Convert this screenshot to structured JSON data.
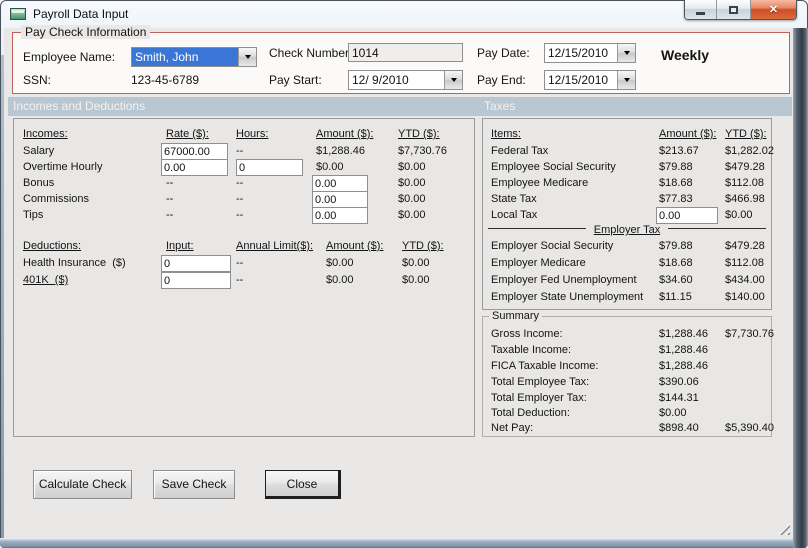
{
  "window": {
    "title": "Payroll Data Input"
  },
  "icons": {
    "app": "form-window-icon",
    "minimize": "minimize-glyph",
    "maximize": "maximize-glyph",
    "close_glyph": "✕"
  },
  "colors": {
    "groupbox_border": "#C0605C",
    "band_bg": "#B9C7D3",
    "selection_bg": "#3A76D6",
    "close_button_red": "#CE4E26"
  },
  "paycheck": {
    "group_label": "Pay Check Information",
    "employee_name_label": "Employee Name:",
    "employee_name_value": "Smith, John",
    "ssn_label": "SSN:",
    "ssn_value": "123-45-6789",
    "check_number_label": "Check Number:",
    "check_number_value": "1014",
    "pay_start_label": "Pay Start:",
    "pay_start_value": "12/ 9/2010",
    "pay_date_label": "Pay Date:",
    "pay_date_value": "12/15/2010",
    "pay_end_label": "Pay End:",
    "pay_end_value": "12/15/2010",
    "frequency": "Weekly"
  },
  "bands": {
    "left": "Incomes and Deductions",
    "right": "Taxes"
  },
  "inc": {
    "h0": "Incomes:",
    "h1": "Rate ($):",
    "h2": "Hours:",
    "h3": "Amount ($):",
    "h4": "YTD ($):",
    "rows": [
      {
        "label": "Salary",
        "rate": "67000.00",
        "hours": "--",
        "amount": "$1,288.46",
        "ytd": "$7,730.76"
      },
      {
        "label": "Overtime Hourly",
        "rate": "0.00",
        "hours": "0",
        "amount": "$0.00",
        "ytd": "$0.00"
      },
      {
        "label": "Bonus",
        "rate": "--",
        "hours": "--",
        "amount": "0.00",
        "ytd": "$0.00"
      },
      {
        "label": "Commissions",
        "rate": "--",
        "hours": "--",
        "amount": "0.00",
        "ytd": "$0.00"
      },
      {
        "label": "Tips",
        "rate": "--",
        "hours": "--",
        "amount": "0.00",
        "ytd": "$0.00"
      }
    ]
  },
  "ded": {
    "h0": "Deductions:",
    "h1": "Input:",
    "h2": "Annual Limit($):",
    "h3": "Amount ($):",
    "h4": "YTD ($):",
    "rows": [
      {
        "label": "Health Insurance  ($)",
        "input": "0",
        "limit": "--",
        "amount": "$0.00",
        "ytd": "$0.00"
      },
      {
        "label": "401K  ($)",
        "input": "0",
        "limit": "--",
        "amount": "$0.00",
        "ytd": "$0.00"
      }
    ]
  },
  "tax": {
    "h0": "Items:",
    "h1": "Amount ($):",
    "h2": "YTD ($):",
    "rows": [
      {
        "label": "Federal Tax",
        "amount": "$213.67",
        "ytd": "$1,282.02"
      },
      {
        "label": "Employee Social Security",
        "amount": "$79.88",
        "ytd": "$479.28"
      },
      {
        "label": "Employee Medicare",
        "amount": "$18.68",
        "ytd": "$112.08"
      },
      {
        "label": "State Tax",
        "amount": "$77.83",
        "ytd": "$466.98"
      },
      {
        "label": "Local Tax",
        "amount": "0.00",
        "ytd": "$0.00"
      }
    ],
    "employer_label": "Employer Tax",
    "emp_rows": [
      {
        "label": "Employer Social Security",
        "amount": "$79.88",
        "ytd": "$479.28"
      },
      {
        "label": "Employer Medicare",
        "amount": "$18.68",
        "ytd": "$112.08"
      },
      {
        "label": "Employer Fed Unemployment",
        "amount": "$34.60",
        "ytd": "$434.00"
      },
      {
        "label": "Employer State Unemployment",
        "amount": "$11.15",
        "ytd": "$140.00"
      }
    ]
  },
  "summary": {
    "group_label": "Summary",
    "rows": [
      {
        "label": "Gross Income:",
        "amount": "$1,288.46",
        "ytd": "$7,730.76"
      },
      {
        "label": "Taxable Income:",
        "amount": "$1,288.46",
        "ytd": ""
      },
      {
        "label": "FICA Taxable Income:",
        "amount": "$1,288.46",
        "ytd": ""
      },
      {
        "label": "Total Employee Tax:",
        "amount": "$390.06",
        "ytd": ""
      },
      {
        "label": "Total Employer Tax:",
        "amount": "$144.31",
        "ytd": ""
      },
      {
        "label": "Total Deduction:",
        "amount": "$0.00",
        "ytd": ""
      },
      {
        "label": "Net Pay:",
        "amount": "$898.40",
        "ytd": "$5,390.40"
      }
    ]
  },
  "buttons": {
    "calculate": "Calculate Check",
    "save": "Save Check",
    "close": "Close"
  }
}
